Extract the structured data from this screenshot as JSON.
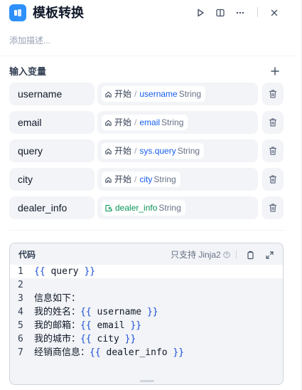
{
  "header": {
    "title": "模板转换",
    "icon": "template-node-icon",
    "actions": [
      "run-icon",
      "split-view-icon",
      "more-icon",
      "close-icon"
    ]
  },
  "description": {
    "placeholder": "添加描述..."
  },
  "input_vars": {
    "section_title": "输入变量",
    "rows": [
      {
        "name": "username",
        "node": "开始",
        "sep": "/",
        "var": "username",
        "type": "String"
      },
      {
        "name": "email",
        "node": "开始",
        "sep": "/",
        "var": "email",
        "type": "String"
      },
      {
        "name": "query",
        "node": "开始",
        "sep": "/",
        "var": "sys.query",
        "type": "String"
      },
      {
        "name": "city",
        "node": "开始",
        "sep": "/",
        "var": "city",
        "type": "String"
      },
      {
        "name": "dealer_info",
        "var": "dealer_info",
        "type": "String"
      }
    ]
  },
  "code": {
    "title": "代码",
    "hint": "只支持 Jinja2",
    "lines": [
      {
        "num": "1",
        "pre": "",
        "var": "query"
      },
      {
        "num": "2",
        "pre": "",
        "var": ""
      },
      {
        "num": "3",
        "pre": "信息如下：",
        "var": ""
      },
      {
        "num": "4",
        "pre": "我的姓名：",
        "var": "username"
      },
      {
        "num": "5",
        "pre": "我的邮箱：",
        "var": "email"
      },
      {
        "num": "6",
        "pre": "我的城市：",
        "var": "city"
      },
      {
        "num": "7",
        "pre": "经销商信息：",
        "var": "dealer_info"
      }
    ]
  },
  "colors": {
    "accent": "#155eef",
    "env_var": "#079455",
    "app_icon": "#2e90fa"
  }
}
